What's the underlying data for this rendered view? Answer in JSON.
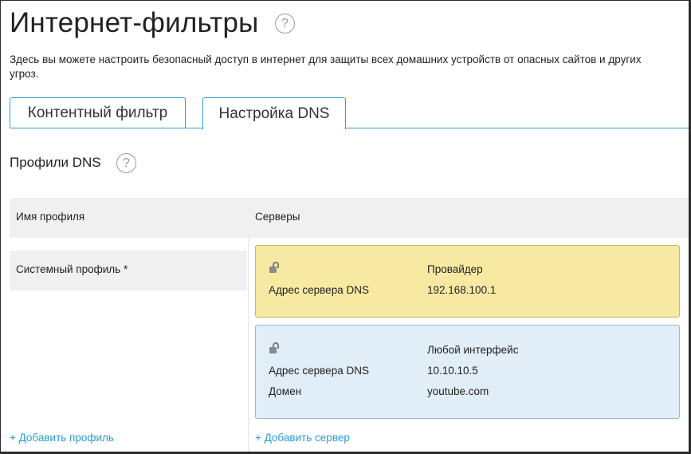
{
  "page": {
    "title": "Интернет-фильтры",
    "help_symbol": "?",
    "description": "Здесь вы можете настроить безопасный доступ в интернет для защиты всех домашних устройств от опасных сайтов и других угроз."
  },
  "tabs": [
    {
      "label": "Контентный фильтр",
      "active": false
    },
    {
      "label": "Настройка DNS",
      "active": true
    }
  ],
  "dns_profiles": {
    "title": "Профили DNS",
    "help_symbol": "?",
    "columns": {
      "name": "Имя профиля",
      "servers": "Серверы"
    },
    "profiles": [
      {
        "name": "Системный профиль *"
      }
    ],
    "servers": [
      {
        "icon": "lock-open-icon",
        "color": "#f8e9a2",
        "interface": "Провайдер",
        "dns_label": "Адрес сервера DNS",
        "dns_value": "192.168.100.1"
      },
      {
        "icon": "lock-open-icon",
        "color": "#e1eef7",
        "interface": "Любой интерфейс",
        "dns_label": "Адрес сервера DNS",
        "dns_value": "10.10.10.5",
        "domain_label": "Домен",
        "domain_value": "youtube.com"
      }
    ],
    "add_profile_label": "+ Добавить профиль",
    "add_server_label": "+ Добавить сервер"
  },
  "colors": {
    "accent": "#2a9cd8",
    "header_bg": "#f0f0f0"
  }
}
